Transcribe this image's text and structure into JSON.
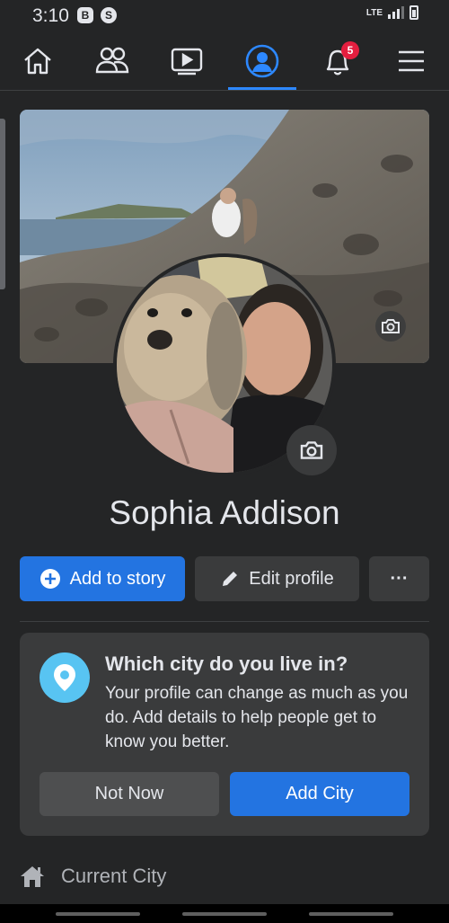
{
  "status_bar": {
    "time": "3:10",
    "left_icons": [
      "b-icon",
      "shazam-icon"
    ],
    "network": "LTE",
    "battery_icon": "battery-icon"
  },
  "nav": {
    "items": [
      {
        "name": "home",
        "icon": "home-icon"
      },
      {
        "name": "friends",
        "icon": "friends-icon"
      },
      {
        "name": "watch",
        "icon": "video-icon"
      },
      {
        "name": "profile",
        "icon": "profile-icon",
        "active": true
      },
      {
        "name": "notifications",
        "icon": "bell-icon",
        "badge": "5"
      },
      {
        "name": "menu",
        "icon": "hamburger-icon"
      }
    ],
    "notification_badge": "5",
    "accent_color": "#2d88ff"
  },
  "profile": {
    "name": "Sophia Addison",
    "add_to_story_label": "Add to story",
    "edit_profile_label": "Edit profile",
    "more_label": "···"
  },
  "prompt_card": {
    "title": "Which city do you live in?",
    "body": "Your profile can change as much as you do. Add details to help people get to know you better.",
    "not_now_label": "Not Now",
    "add_city_label": "Add City"
  },
  "details": {
    "current_city_label": "Current City"
  },
  "colors": {
    "background": "#242526",
    "primary_button": "#2374e1",
    "card": "#3a3b3c",
    "badge": "#e41e3f",
    "location_icon": "#58c4f2"
  }
}
